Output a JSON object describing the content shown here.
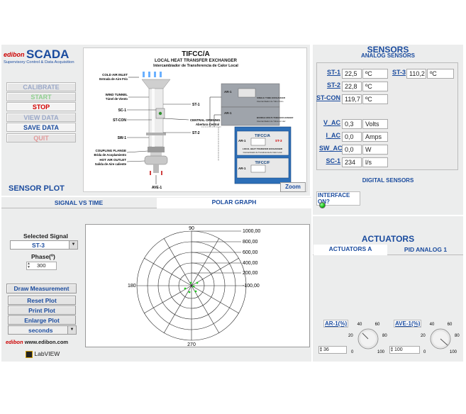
{
  "brand": {
    "edibon": "edibon",
    "scada": "SCADA",
    "subtitle": "Supervisory Control & Data Acquisition",
    "url": "www.edibon.com",
    "labview": "LabVIEW"
  },
  "menu": {
    "calibrate": "CALIBRATE",
    "start": "START",
    "stop": "STOP",
    "view_data": "VIEW DATA",
    "save_data": "SAVE DATA",
    "quit": "QUIT"
  },
  "diagram": {
    "title": "TIFCC/A",
    "subtitle1": "LOCAL HEAT TRANSFER EXCHANGER",
    "subtitle2": "Intercambiador de Transferencia de Calor Local",
    "cold_air_inlet": "COLD AIR INLET",
    "cold_air_inlet_es": "Entrada de Aire Frío",
    "wind_tunnel": "WIND TUNNEL",
    "wind_tunnel_es": "Túnel de Viento",
    "sc1": "SC-1",
    "st_con": "ST-CON",
    "sw1": "SW-1",
    "st1": "ST-1",
    "st2": "ST-2",
    "central_opening": "CENTRAL OPENING",
    "central_opening_es": "Abertura Central",
    "coupling_flange": "COUPLING FLANGE",
    "coupling_flange_es": "Brida de Acoplamiento",
    "hot_air_outlet": "HOT AIR OUTLET",
    "hot_air_outlet_es": "Salida de Aire caliente",
    "ave1": "AVE-1",
    "ar1": "AR-1",
    "single_tube": "SINGLE TUBE EXCHANGER",
    "single_tube_es": "Intercambiador de Tubo Único",
    "bundle_tube": "BUNDLE MULTI-TUBE EXCHANGER",
    "bundle_tube_es": "Intercambiador de Tubos en Haz",
    "tifcc_a": "TIFCC/A",
    "st3": "ST-3",
    "local_heat": "LOCAL HEAT TRANSFER EXCHANGER",
    "local_heat_es": "Intercambiador de Transferencia de Calor Local",
    "tifcc_f": "TIFCC/F",
    "zoom": "Zoom"
  },
  "sensors": {
    "title": "SENSORS",
    "analog": "ANALOG SENSORS",
    "rows": [
      {
        "label": "ST-1",
        "value": "22,5",
        "unit": "ºC"
      },
      {
        "label": "ST-2",
        "value": "22,8",
        "unit": "ºC"
      },
      {
        "label": "ST-CON",
        "value": "119,7",
        "unit": "ºC"
      },
      {
        "label": "V_AC",
        "value": "0,3",
        "unit": "Volts"
      },
      {
        "label": "I_AC",
        "value": "0,0",
        "unit": "Amps"
      },
      {
        "label": "SW_AC",
        "value": "0,0",
        "unit": "W"
      },
      {
        "label": "SC-1",
        "value": "234",
        "unit": "l/s"
      }
    ],
    "st3": {
      "label": "ST-3",
      "value": "110,2",
      "unit": "ºC"
    },
    "digital": "DIGITAL SENSORS",
    "interface": "INTERFACE ON?"
  },
  "actuators": {
    "title": "ACTUATORS",
    "tab_a": "ACTUATORS A",
    "tab_pid": "PID ANALOG 1",
    "ar1": {
      "label": "AR-1(%)",
      "value": "36",
      "ticks": [
        "0",
        "20",
        "40",
        "60",
        "80",
        "100"
      ]
    },
    "ave1": {
      "label": "AVE-1(%)",
      "value": "100",
      "ticks": [
        "0",
        "20",
        "40",
        "60",
        "80",
        "100"
      ]
    }
  },
  "plot": {
    "title": "SENSOR PLOT",
    "tab_signal": "SIGNAL VS TIME",
    "tab_polar": "POLAR GRAPH",
    "selected_signal_label": "Selected Signal",
    "selected_signal": "ST-3",
    "phase_label": "Phase(º)",
    "phase_value": "300",
    "draw": "Draw Measurement",
    "reset": "Reset Plot",
    "print": "Print Plot",
    "enlarge": "Enlarge Plot",
    "units": "seconds",
    "angle_90": "90",
    "angle_180": "180",
    "angle_270": "270",
    "radii": [
      "1000,00",
      "800,00",
      "600,00",
      "400,00",
      "200,00",
      "-100,00"
    ]
  },
  "colors": {
    "blue": "#1a4b9e",
    "green_led": "#22cc22",
    "red_stop": "#d40000"
  }
}
